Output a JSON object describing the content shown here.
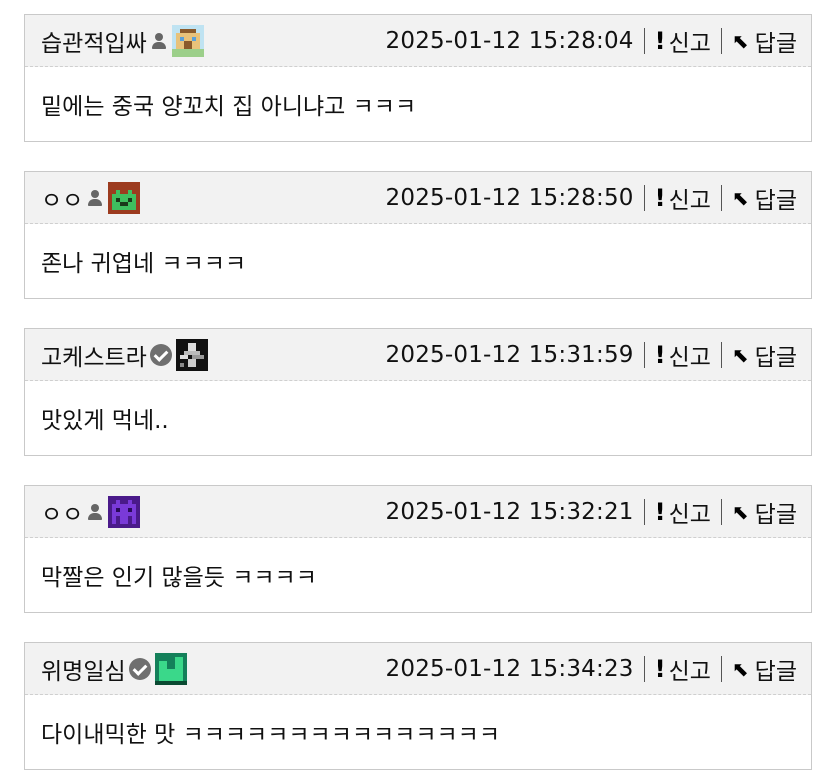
{
  "actions": {
    "report_label": "신고",
    "reply_label": "답글"
  },
  "comments": [
    {
      "nickname": "습관적입싸",
      "badge": "user-icon",
      "avatar": "pixel-building-avatar",
      "timestamp": "2025-01-12 15:28:04",
      "text": "밑에는 중국 양꼬치 집 아니냐고 ㅋㅋㅋ"
    },
    {
      "nickname": "ㅇㅇ",
      "badge": "user-icon",
      "avatar": "pixel-green-creature-avatar",
      "timestamp": "2025-01-12 15:28:50",
      "text": "존나 귀엽네 ㅋㅋㅋㅋ"
    },
    {
      "nickname": "고케스트라",
      "badge": "verified-icon",
      "avatar": "pixel-dark-figure-avatar",
      "timestamp": "2025-01-12 15:31:59",
      "text": "맛있게 먹네.."
    },
    {
      "nickname": "ㅇㅇ",
      "badge": "user-icon",
      "avatar": "pixel-purple-invader-avatar",
      "timestamp": "2025-01-12 15:32:21",
      "text": "막짤은 인기 많을듯 ㅋㅋㅋㅋ"
    },
    {
      "nickname": "위명일심",
      "badge": "verified-icon",
      "avatar": "pixel-green-blocks-avatar",
      "timestamp": "2025-01-12 15:34:23",
      "text": "다이내믹한 맛 ㅋㅋㅋㅋㅋㅋㅋㅋㅋㅋㅋㅋㅋㅋㅋ"
    }
  ]
}
